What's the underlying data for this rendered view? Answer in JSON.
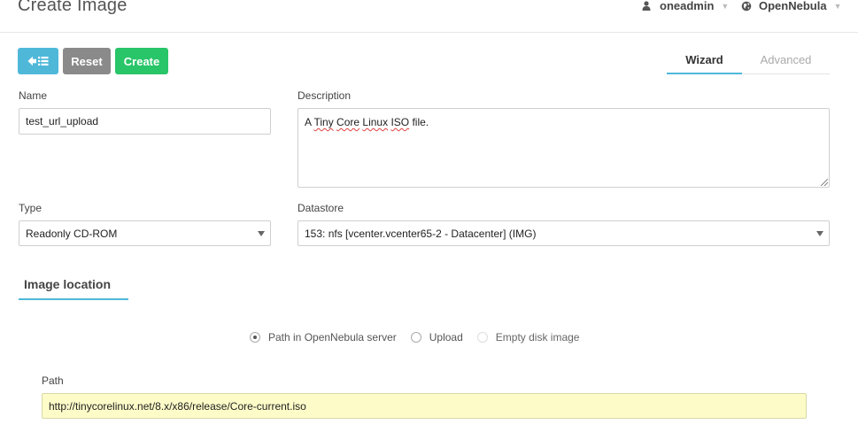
{
  "header": {
    "title": "Create Image",
    "user": "oneadmin",
    "zone": "OpenNebula",
    "user_icon": "user-icon",
    "zone_icon": "globe-icon"
  },
  "toolbar": {
    "back_icon": "arrow-left-list-icon",
    "reset_label": "Reset",
    "create_label": "Create",
    "colors": {
      "back": "#4fb8d9",
      "reset": "#8a8a8a",
      "create": "#29c569"
    }
  },
  "wizard_tabs": [
    {
      "label": "Wizard",
      "active": true
    },
    {
      "label": "Advanced",
      "active": false
    }
  ],
  "form": {
    "name": {
      "label": "Name",
      "value": "test_url_upload"
    },
    "description": {
      "label": "Description",
      "value_parts": [
        "A ",
        "Tiny",
        " ",
        "Core",
        " ",
        "Linux",
        " ",
        "ISO",
        " file."
      ]
    },
    "type": {
      "label": "Type",
      "value": "Readonly CD-ROM"
    },
    "datastore": {
      "label": "Datastore",
      "value": "153: nfs [vcenter.vcenter65-2 - Datacenter] (IMG)"
    }
  },
  "image_location": {
    "title": "Image location",
    "options": [
      {
        "label": "Path in OpenNebula server",
        "checked": true,
        "disabled": false
      },
      {
        "label": "Upload",
        "checked": false,
        "disabled": false
      },
      {
        "label": "Empty disk image",
        "checked": false,
        "disabled": true
      }
    ],
    "path": {
      "label": "Path",
      "value": "http://tinycorelinux.net/8.x/x86/release/Core-current.iso"
    }
  },
  "accent_color": "#4fb8d9"
}
